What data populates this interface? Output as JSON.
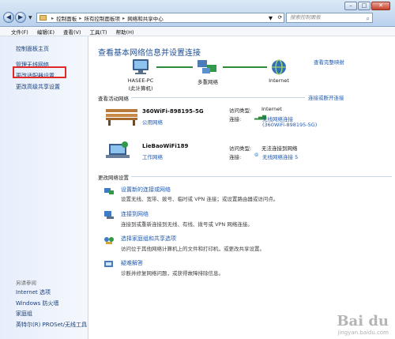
{
  "window": {
    "buttons": [
      "–",
      "□",
      "✕"
    ]
  },
  "address_bar": {
    "segments": [
      "控制面板",
      "所有控制面板项",
      "网络和共享中心"
    ],
    "search_placeholder": "搜索控制面板"
  },
  "menu": [
    "文件(F)",
    "编辑(E)",
    "查看(V)",
    "工具(T)",
    "帮助(H)"
  ],
  "sidebar": {
    "home": "控制面板主页",
    "items": [
      "管理无线网络",
      "更改适配器设置",
      "更改高级共享设置"
    ],
    "see_also_title": "另请参阅",
    "see_also": [
      "Internet 选项",
      "Windows 防火墙",
      "家庭组",
      "英特尔(R) PROSet/无线工具"
    ]
  },
  "main": {
    "heading": "查看基本网络信息并设置连接",
    "full_map_link": "查看完整映射",
    "map_nodes": [
      {
        "label": "HASEE-PC",
        "sublabel": "(此计算机)"
      },
      {
        "label": "多重网络",
        "sublabel": ""
      },
      {
        "label": "Internet",
        "sublabel": ""
      }
    ],
    "active_networks_title": "查看活动网络",
    "connect_disconnect_link": "连接或断开连接",
    "networks": [
      {
        "name": "360WiFi-898195-5G",
        "type": "公用网络",
        "access_label": "访问类型:",
        "access_value": "Internet",
        "conn_label": "连接:",
        "conn_value": "无线网络连接",
        "conn_value2": "(360WiFi-898195-5G)"
      },
      {
        "name": "LieBaoWiFi189",
        "type": "工作网络",
        "access_label": "访问类型:",
        "access_value": "无法连接到网络",
        "conn_label": "连接:",
        "conn_value": "无线网络连接 5",
        "conn_value2": ""
      }
    ],
    "change_settings_title": "更改网络设置",
    "tasks": [
      {
        "title": "设置新的连接或网络",
        "desc": "设置无线、宽带、拨号、临时或 VPN 连接；或设置路由器或访问点。"
      },
      {
        "title": "连接到网络",
        "desc": "连接到或重新连接到无线、有线、拨号或 VPN 网络连接。"
      },
      {
        "title": "选择家庭组和共享选项",
        "desc": "访问位于其他网络计算机上的文件和打印机，或更改共享设置。"
      },
      {
        "title": "疑难解答",
        "desc": "诊断并修复网络问题，或获得故障排除信息。"
      }
    ]
  },
  "watermark": {
    "brand": "Bai du",
    "sub": "jingyan.baidu.com"
  },
  "colors": {
    "link": "#1f5ab0",
    "heading": "#1f4f91",
    "highlight": "#e02a2a"
  }
}
